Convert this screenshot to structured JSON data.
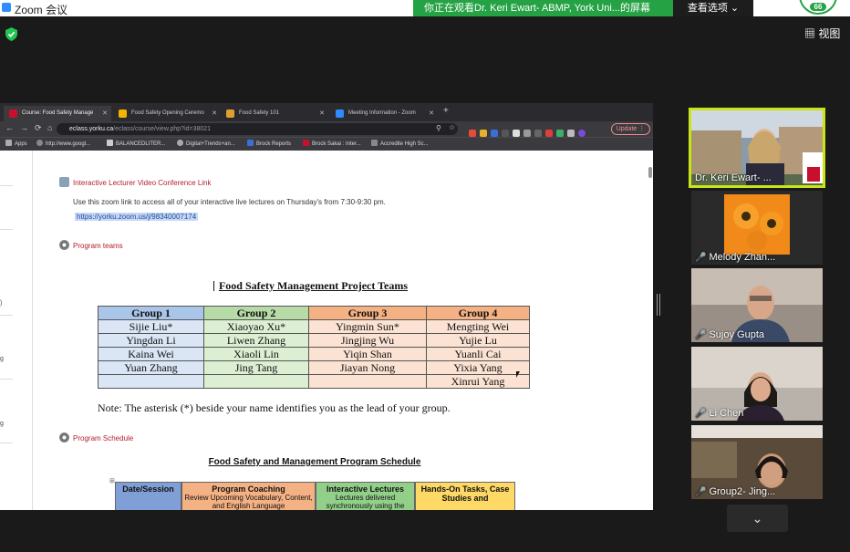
{
  "window": {
    "title": "Zoom 会议"
  },
  "banner": {
    "text": "你正在观看Dr. Keri Ewart- ABMP, York Uni...的屏幕",
    "view_options": "查看选项 ⌄",
    "badge": "66"
  },
  "toolbar": {
    "view_label": "视图"
  },
  "browser": {
    "tabs": [
      {
        "label": "Course: Food Safety Manage",
        "color": "#c8102e"
      },
      {
        "label": "Food Safety Opening Ceremo",
        "color": "#f4b400"
      },
      {
        "label": "Food Safety 101",
        "color": "#e0a030"
      },
      {
        "label": "Meeting Information - Zoom",
        "color": "#2d8cff"
      }
    ],
    "url_host": "eclass.yorku.ca",
    "url_path": "/eclass/course/view.php?id=38021",
    "update_label": "Update ⋮",
    "bookmarks": [
      {
        "label": "Apps",
        "color": "#aaa"
      },
      {
        "label": "http://www.googl...",
        "color": "#888"
      },
      {
        "label": "BALANCEDLITER...",
        "color": "#ccc"
      },
      {
        "label": "Digital+Trends+an...",
        "color": "#aaa"
      },
      {
        "label": "Brock Reports",
        "color": "#3a6fd8"
      },
      {
        "label": "Brock Sakai : Inter...",
        "color": "#c8102e"
      },
      {
        "label": "Accredite High Sc...",
        "color": "#888"
      }
    ]
  },
  "page": {
    "lecturer_link": "Interactive Lecturer Video Conference Link",
    "lecture_desc": "Use this zoom link to access all of your interactive live lectures on Thursday's from 7:30-9:30 pm.",
    "zoom_url": "https://yorku.zoom.us/j/98340007174",
    "program_teams": "Program teams",
    "teams_title": "Food Safety Management Project Teams",
    "groups": [
      {
        "header": "Group 1",
        "color": "#a9c5e8",
        "members": [
          "Sijie Liu*",
          "Yingdan Li",
          "Kaina Wei",
          "Yuan Zhang",
          ""
        ]
      },
      {
        "header": "Group 2",
        "color": "#b7dba6",
        "members": [
          "Xiaoyao Xu*",
          "Liwen Zhang",
          "Xiaoli Lin",
          "Jing Tang",
          ""
        ]
      },
      {
        "header": "Group 3",
        "color": "#f4b183",
        "members": [
          "Yingmin Sun*",
          "Jingjing Wu",
          "Yiqin Shan",
          "Jiayan Nong",
          ""
        ]
      },
      {
        "header": "Group 4",
        "color": "#f4b183",
        "members": [
          "Mengting Wei",
          "Yujie Lu",
          "Yuanli Cai",
          "Yixia Yang",
          "Xinrui Yang"
        ]
      }
    ],
    "group_body_colors": [
      "#dae6f5",
      "#dcefd3",
      "#fbe2d2",
      "#fbe2d2"
    ],
    "note": "Note: The asterisk (*) beside your name identifies you as the lead of your group.",
    "program_schedule": "Program Schedule",
    "schedule_title": "Food Safety and Management Program Schedule",
    "schedule_headers": [
      {
        "title": "Date/Session",
        "sub": "",
        "color": "#7f9fd6"
      },
      {
        "title": "Program Coaching",
        "sub": "Review Upcoming Vocabulary, Content, and English Language",
        "color": "#f4b183"
      },
      {
        "title": "Interactive Lectures",
        "sub": "Lectures delivered synchronously using the",
        "color": "#92d08a"
      },
      {
        "title": "Hands-On Tasks, Case Studies and",
        "sub": "",
        "color": "#ffd966"
      }
    ],
    "left_chars": [
      ")",
      "g",
      "g",
      "g"
    ]
  },
  "participants": [
    {
      "name": "Dr. Keri Ewart- ...",
      "muted": false,
      "active": true
    },
    {
      "name": "Melody Zhan...",
      "muted": true,
      "active": false
    },
    {
      "name": "Sujoy Gupta",
      "muted": true,
      "active": false
    },
    {
      "name": "Li Chen",
      "muted": true,
      "active": false
    },
    {
      "name": "Group2- Jing...",
      "muted": true,
      "active": false
    }
  ]
}
